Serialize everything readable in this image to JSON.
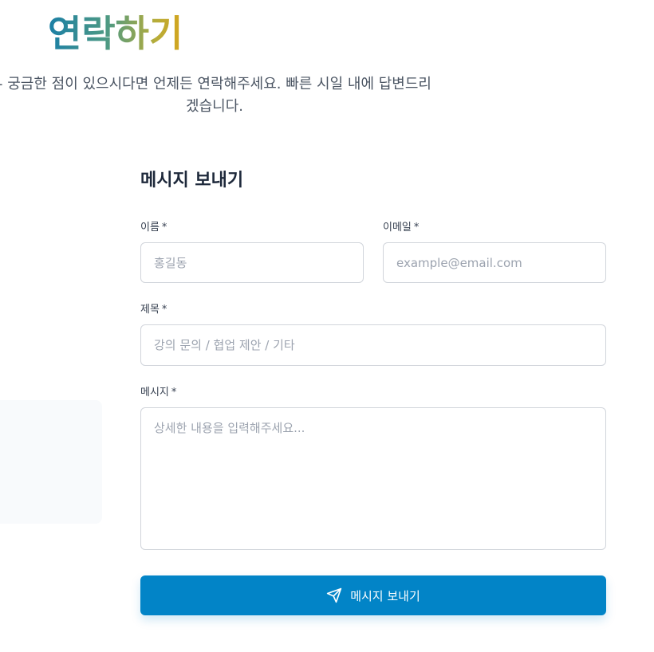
{
  "header": {
    "title": "연락하기",
    "intro": "- 궁금한 점이 있으시다면 언제든 연락해주세요. 빠른 시일 내에 답변드리겠습니다."
  },
  "form": {
    "title": "메시지 보내기",
    "required_mark": "*",
    "name": {
      "label": "이름",
      "placeholder": "홍길동",
      "value": ""
    },
    "email": {
      "label": "이메일",
      "placeholder": "example@email.com",
      "value": ""
    },
    "subject": {
      "label": "제목",
      "placeholder": "강의 문의 / 협업 제안 / 기타",
      "value": ""
    },
    "message": {
      "label": "메시지",
      "placeholder": "상세한 내용을 입력해주세요...",
      "value": ""
    },
    "submit_label": "메시지 보내기",
    "submit_icon": "send-icon"
  },
  "colors": {
    "accent": "#0284c7",
    "title_gradient": [
      "#1b7fa6",
      "#4f9a82",
      "#b7ad3a",
      "#d4a41c"
    ]
  }
}
